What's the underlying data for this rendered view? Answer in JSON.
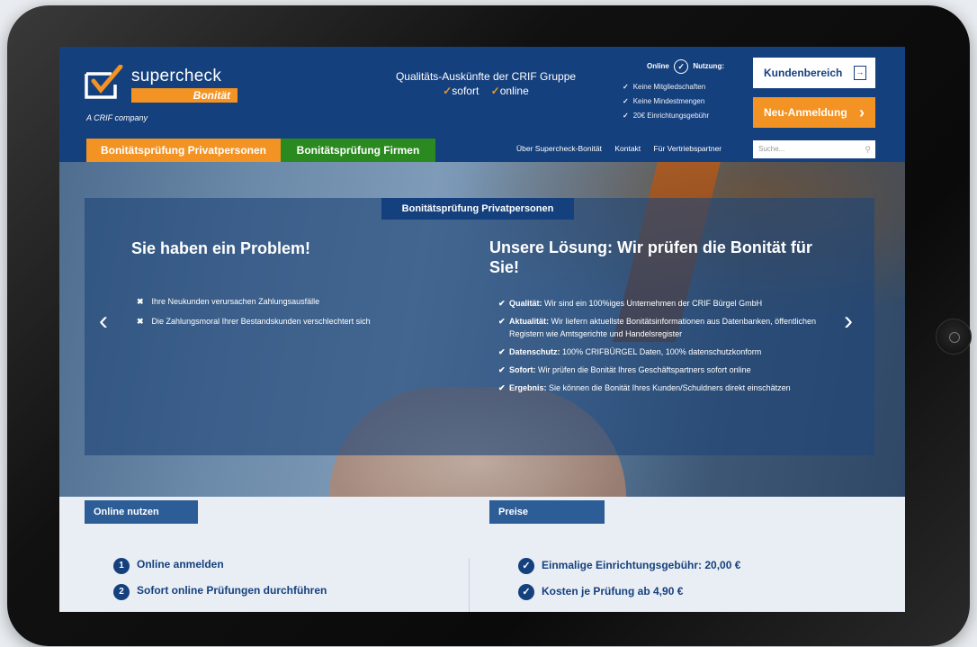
{
  "brand": {
    "name": "supercheck",
    "sub": "Bonität",
    "company": "A CRIF company"
  },
  "header": {
    "tagline": "Qualitäts-Auskünfte der CRIF Gruppe",
    "tagline_checks": [
      "sofort",
      "online"
    ],
    "usage_title_left": "Online",
    "usage_title_right": "Nutzung:",
    "usage_items": [
      "Keine Mitgliedschaften",
      "Keine Mindestmengen",
      "20€ Einrichtungsgebühr"
    ],
    "kunden_button": "Kundenbereich",
    "neu_button": "Neu-Anmeldung"
  },
  "nav": {
    "tab_private": "Bonitätsprüfung Privatpersonen",
    "tab_firms": "Bonitätsprüfung Firmen",
    "links": [
      "Über Supercheck-Bonität",
      "Kontakt",
      "Für Vertriebspartner"
    ],
    "search_placeholder": "Suche..."
  },
  "hero": {
    "panel_tab": "Bonitätsprüfung Privatpersonen",
    "left_title": "Sie haben ein Problem!",
    "problems": [
      "Ihre Neukunden verursachen Zahlungsausfälle",
      "Die Zahlungsmoral Ihrer Bestandskunden verschlechtert sich"
    ],
    "right_title": "Unsere Lösung: Wir prüfen die Bonität für Sie!",
    "solutions": [
      {
        "label": "Qualität:",
        "text": " Wir sind ein 100%iges Unternehmen der CRIF Bürgel GmbH"
      },
      {
        "label": "Aktualität:",
        "text": " Wir liefern aktuellste Bonitätsinformationen aus Datenbanken, öffentlichen Registern wie Amtsgerichte und Handelsregister"
      },
      {
        "label": "Datenschutz:",
        "text": " 100% CRIFBÜRGEL Daten, 100% datenschutzkonform"
      },
      {
        "label": "Sofort:",
        "text": " Wir prüfen die Bonität Ihres Geschäftspartners sofort online"
      },
      {
        "label": "Ergebnis:",
        "text": " Sie können die Bonität Ihres Kunden/Schuldners direkt einschätzen"
      }
    ]
  },
  "lower": {
    "left_heading": "Online nutzen",
    "right_heading": "Preise",
    "steps": [
      {
        "num": "1",
        "text": "Online anmelden"
      },
      {
        "num": "2",
        "text": "Sofort online Prüfungen durchführen"
      }
    ],
    "prices": [
      "Einmalige Einrichtungsgebühr: 20,00 €",
      "Kosten je Prüfung ab 4,90 €"
    ]
  },
  "colors": {
    "header_blue": "#15407e",
    "orange": "#f39323",
    "green": "#2a8a1f"
  },
  "icons": [
    "checkmark-logo-icon",
    "shield-check-icon",
    "login-icon",
    "chevron-right-icon",
    "search-icon",
    "chevron-left-icon",
    "close-x-icon",
    "check-icon",
    "number-badge-icon",
    "check-circle-icon"
  ]
}
